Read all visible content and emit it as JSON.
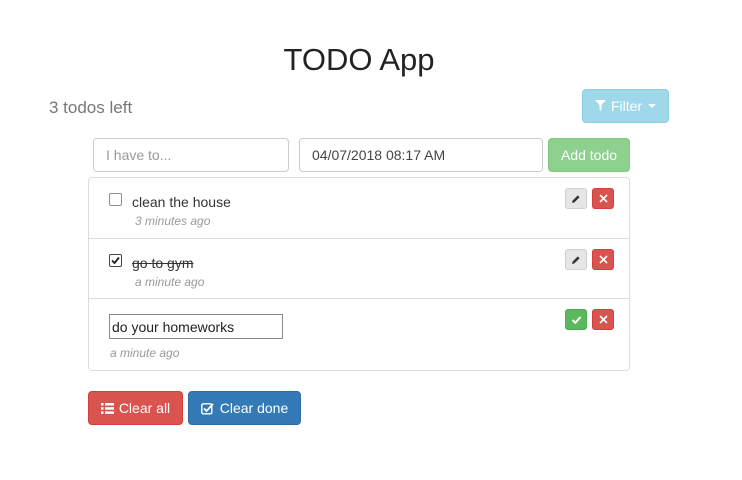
{
  "app": {
    "title": "TODO App"
  },
  "summary": {
    "left_text": "3 todos left"
  },
  "filter": {
    "label": "Filter",
    "color": "#9fd8ea",
    "icon": "filter-icon"
  },
  "new_todo": {
    "placeholder": "I have to...",
    "value": ""
  },
  "date_field": {
    "value": "04/07/2018 08:17 AM"
  },
  "add_button": {
    "label": "Add todo",
    "color": "#8ed08e"
  },
  "todos": [
    {
      "text": "clean the house",
      "time": "3 minutes ago",
      "done": false,
      "editing": false
    },
    {
      "text": "go to gym",
      "time": "a minute ago",
      "done": true,
      "editing": false
    },
    {
      "text": "do your homeworks",
      "time": "a minute ago",
      "done": false,
      "editing": true
    }
  ],
  "actions": {
    "clear_all": {
      "label": "Clear all",
      "color": "#d9534f",
      "icon": "list-icon"
    },
    "clear_done": {
      "label": "Clear done",
      "color": "#337ab7",
      "icon": "check-square-icon"
    }
  },
  "icons": {
    "edit": "pencil-icon",
    "delete": "close-icon",
    "save": "checkmark-icon"
  }
}
